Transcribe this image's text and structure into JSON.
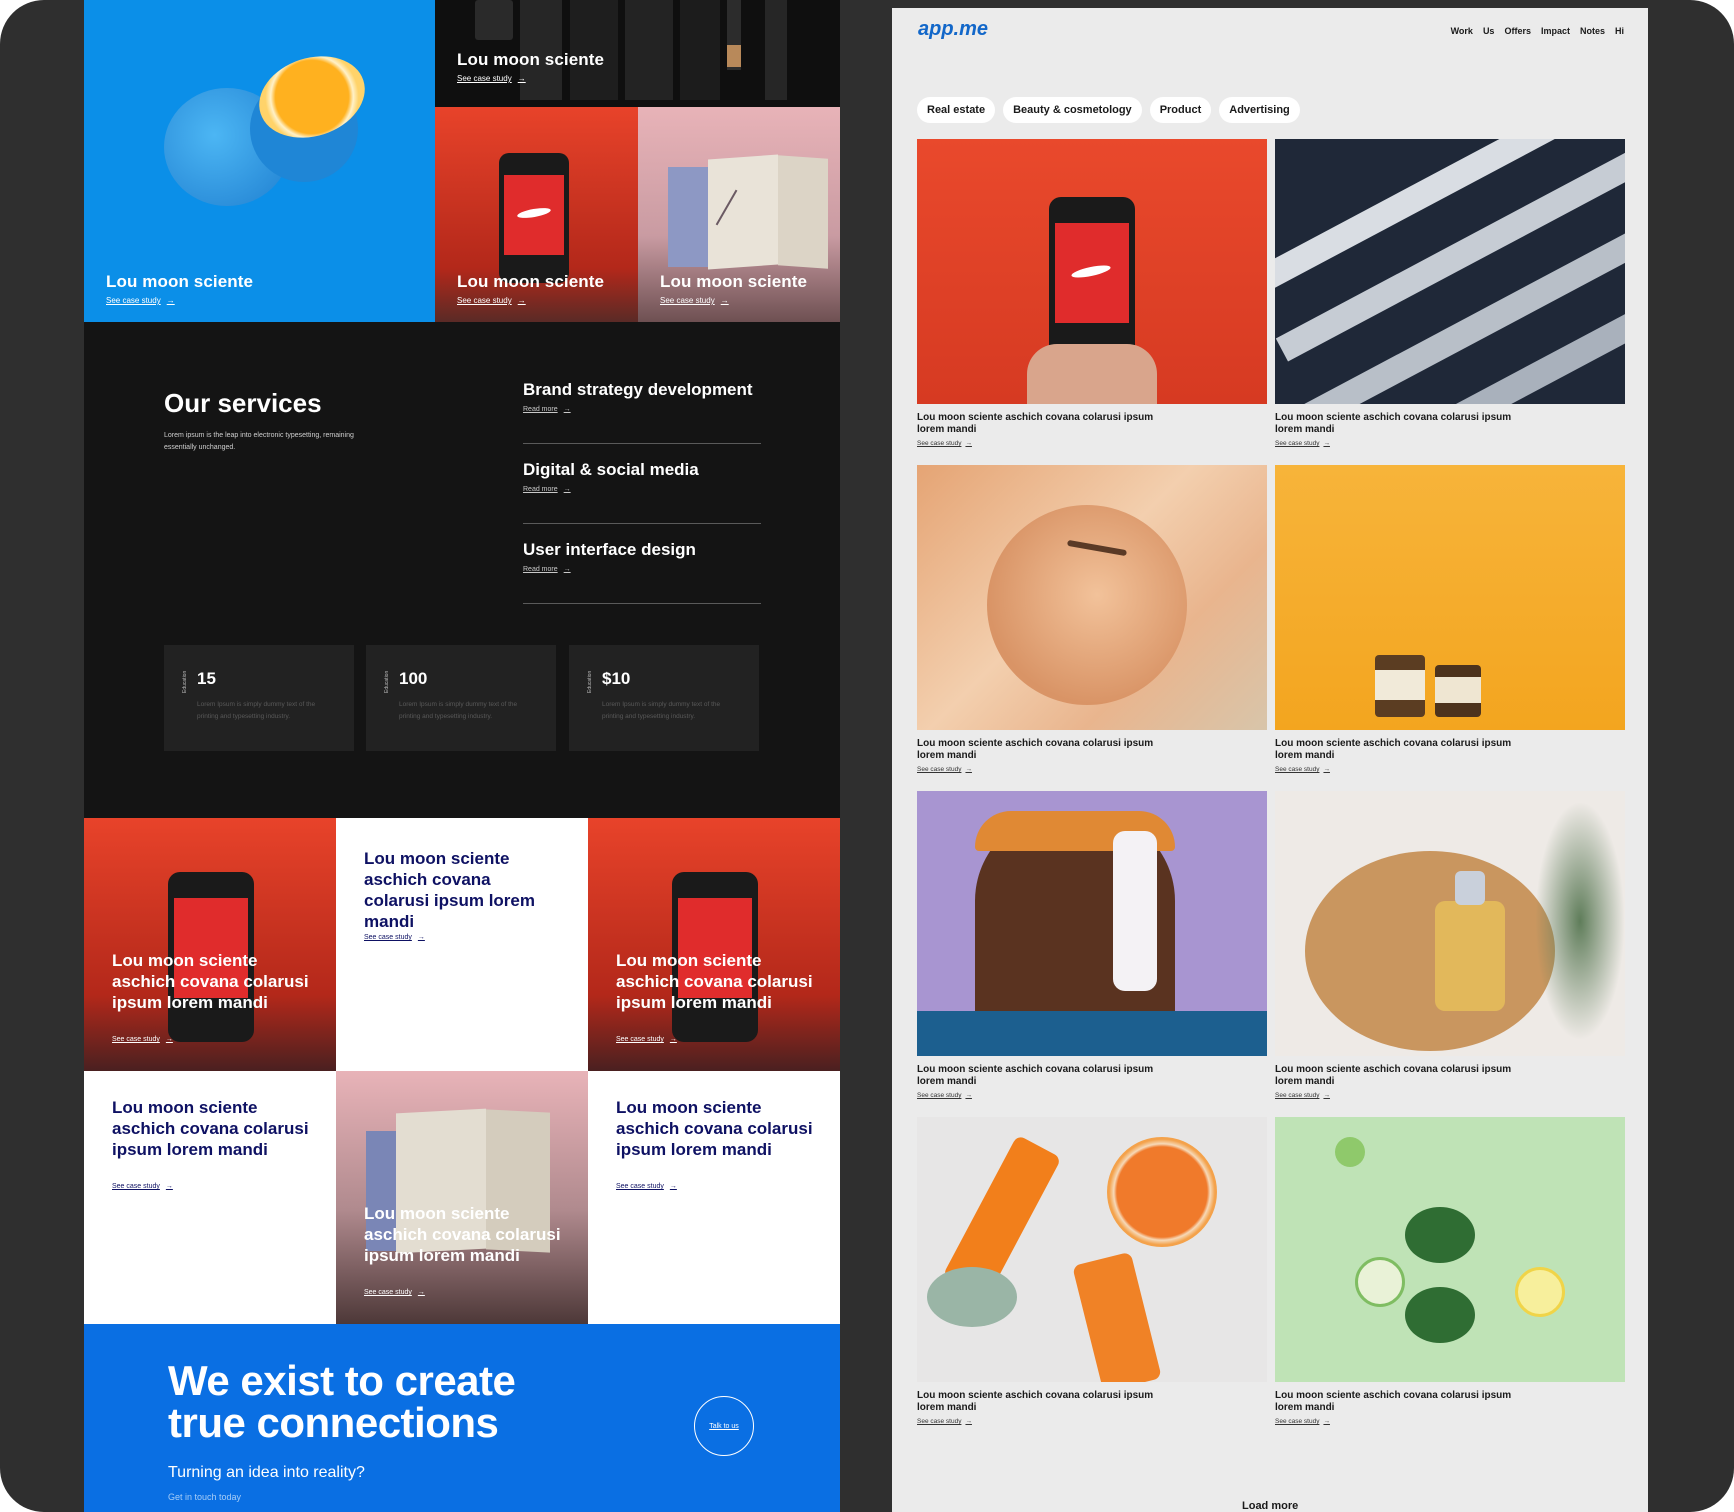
{
  "left": {
    "hero_tiles": [
      {
        "title": "Lou moon sciente",
        "link": "See case study"
      },
      {
        "title": "Lou moon sciente",
        "link": "See case study"
      },
      {
        "title": "Lou moon sciente",
        "link": "See case study"
      },
      {
        "title": "Lou moon sciente",
        "link": "See case study"
      }
    ],
    "services": {
      "title": "Our services",
      "description": "Lorem ipsum is the leap into electronic typesetting, remaining essentially unchanged.",
      "items": [
        {
          "name": "Brand strategy development",
          "link": "Read more"
        },
        {
          "name": "Digital & social media",
          "link": "Read more"
        },
        {
          "name": "User interface design",
          "link": "Read more"
        }
      ],
      "stats": [
        {
          "tag": "Education",
          "value": "15",
          "desc": "Lorem Ipsum is simply dummy text of the printing and typesetting industry."
        },
        {
          "tag": "Education",
          "value": "100",
          "desc": "Lorem Ipsum is simply dummy text of the printing and typesetting industry."
        },
        {
          "tag": "Education",
          "value": "$10",
          "desc": "Lorem Ipsum is simply dummy text of the printing and typesetting industry."
        }
      ]
    },
    "grid": [
      {
        "title": "Lou moon sciente aschich covana colarusi ipsum lorem mandi",
        "link": "See case study"
      },
      {
        "title": "Lou moon sciente aschich covana colarusi ipsum lorem mandi",
        "link": "See case study"
      },
      {
        "title": "Lou moon sciente aschich covana colarusi ipsum lorem mandi",
        "link": "See case study"
      },
      {
        "title": "Lou moon sciente aschich covana colarusi ipsum lorem mandi",
        "link": "See case study"
      },
      {
        "title": "Lou moon sciente aschich covana colarusi ipsum lorem mandi",
        "link": "See case study"
      },
      {
        "title": "Lou moon sciente aschich covana colarusi ipsum lorem mandi",
        "link": "See case study"
      }
    ],
    "cta": {
      "headline_1": "We exist to create",
      "headline_2": "true connections",
      "subtitle": "Turning an idea into reality?",
      "small": "Get in touch today",
      "button": "Talk to us"
    }
  },
  "right": {
    "logo": "app.me",
    "nav": [
      "Work",
      "Us",
      "Offers",
      "Impact",
      "Notes",
      "Hi"
    ],
    "chips": [
      "Real estate",
      "Beauty & cosmetology",
      "Product",
      "Advertising"
    ],
    "cards": [
      {
        "title": "Lou moon sciente aschich covana colarusi ipsum lorem mandi",
        "link": "See case study"
      },
      {
        "title": "Lou moon sciente aschich covana colarusi ipsum lorem mandi",
        "link": "See case study"
      },
      {
        "title": "Lou moon sciente aschich covana colarusi ipsum lorem mandi",
        "link": "See case study"
      },
      {
        "title": "Lou moon sciente aschich covana colarusi ipsum lorem mandi",
        "link": "See case study"
      },
      {
        "title": "Lou moon sciente aschich covana colarusi ipsum lorem mandi",
        "link": "See case study"
      },
      {
        "title": "Lou moon sciente aschich covana colarusi ipsum lorem mandi",
        "link": "See case study"
      },
      {
        "title": "Lou moon sciente aschich covana colarusi ipsum lorem mandi",
        "link": "See case study"
      },
      {
        "title": "Lou moon sciente aschich covana colarusi ipsum lorem mandi",
        "link": "See case study"
      }
    ],
    "load_more": "Load more"
  },
  "icons": {
    "arrow": "→"
  },
  "colors": {
    "brand_blue": "#0a6fe3",
    "logo_blue": "#1267c9",
    "dark_bg": "#141414",
    "navy_text": "#0e1163"
  }
}
